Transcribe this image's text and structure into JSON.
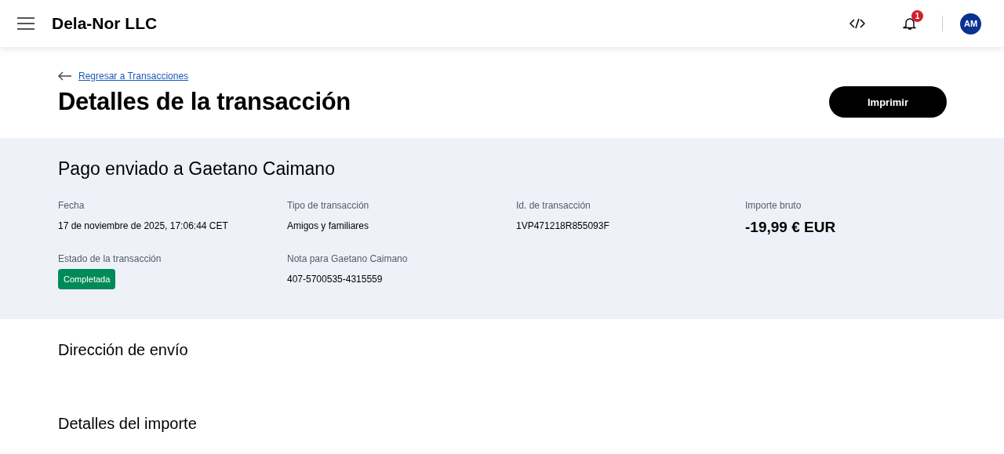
{
  "header": {
    "company": "Dela-Nor LLC",
    "notification_count": "1",
    "avatar_initials": "AM"
  },
  "back_link": "Regresar a Transacciones",
  "page_title": "Detalles de la transacción",
  "print_button": "Imprimir",
  "summary": {
    "title": "Pago enviado a Gaetano Caimano",
    "fields": [
      {
        "label": "Fecha",
        "value": "17 de noviembre de 2025, 17:06:44 CET",
        "kind": "text"
      },
      {
        "label": "Tipo de transacción",
        "value": "Amigos y familiares",
        "kind": "text"
      },
      {
        "label": "Id. de transacción",
        "value": "1VP471218R855093F",
        "kind": "text"
      },
      {
        "label": "Importe bruto",
        "value": "-19,99 € EUR",
        "kind": "amount"
      },
      {
        "label": "Estado de la transacción",
        "value": "Completada",
        "kind": "status",
        "color": "#008a5a"
      },
      {
        "label": "Nota para Gaetano Caimano",
        "value": "407-5700535-4315559",
        "kind": "text"
      }
    ]
  },
  "sections": [
    "Dirección de envío",
    "Detalles del importe"
  ]
}
